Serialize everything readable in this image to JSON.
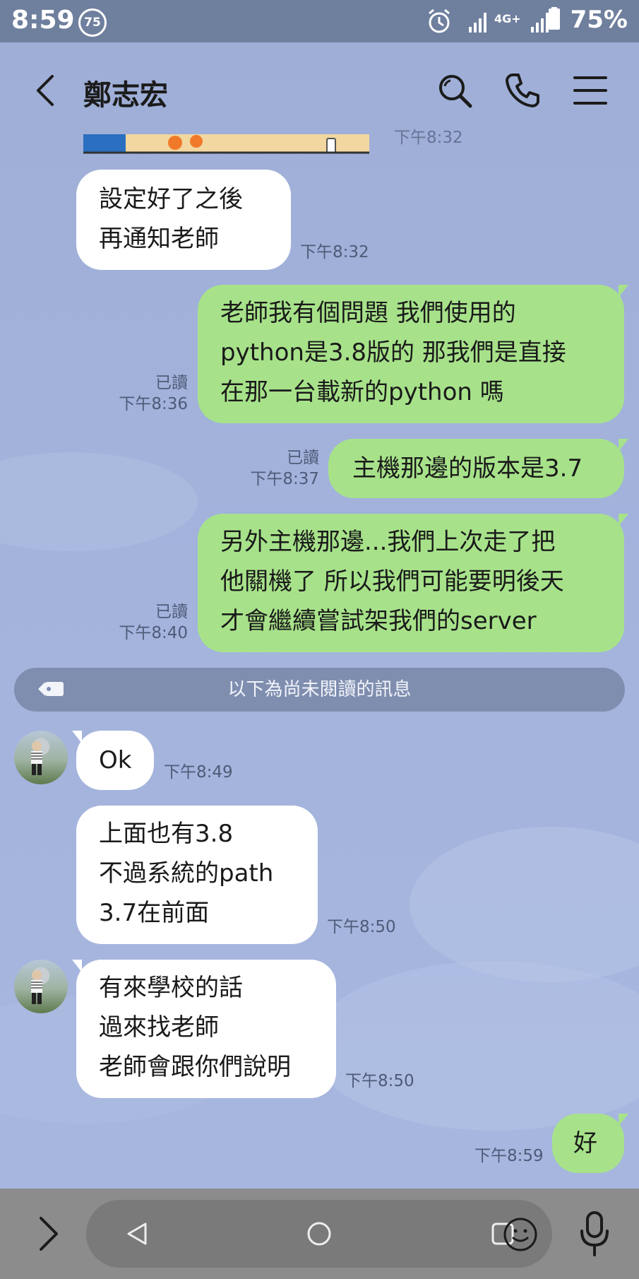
{
  "status_bar": {
    "time": "8:59",
    "notification_count": "75",
    "network": "4G+",
    "battery": "75%"
  },
  "header": {
    "contact_name": "鄭志宏",
    "icons": [
      "back-icon",
      "search-icon",
      "phone-icon",
      "menu-icon"
    ]
  },
  "messages": [
    {
      "side": "in",
      "lines": [
        "設定好了之後",
        "再通知老師"
      ],
      "time": "下午8:32"
    },
    {
      "side": "out",
      "lines": [
        "老師我有個問題 我們使用的",
        "python是3.8版的 那我們是直接",
        "在那一台載新的python 嗎"
      ],
      "read": "已讀",
      "time": "下午8:36"
    },
    {
      "side": "out",
      "lines": [
        "主機那邊的版本是3.7"
      ],
      "read": "已讀",
      "time": "下午8:37"
    },
    {
      "side": "out",
      "lines": [
        "另外主機那邊...我們上次走了把",
        "他關機了 所以我們可能要明後天",
        "才會繼續嘗試架我們的server"
      ],
      "read": "已讀",
      "time": "下午8:40"
    },
    {
      "side": "in",
      "lines": [
        "Ok"
      ],
      "time": "下午8:49"
    },
    {
      "side": "in",
      "lines": [
        "上面也有3.8",
        "不過系統的path",
        "3.7在前面"
      ],
      "time": "下午8:50"
    },
    {
      "side": "in",
      "lines": [
        "有來學校的話",
        "過來找老師",
        "老師會跟你們說明"
      ],
      "time": "下午8:50"
    },
    {
      "side": "out",
      "lines": [
        "好"
      ],
      "time": "下午8:59"
    }
  ],
  "partial_top_time": "下午8:32",
  "unread_divider": "以下為尚未閱讀的訊息",
  "colors": {
    "background": "#a3b3dc",
    "outgoing_bubble": "#a7e28a",
    "incoming_bubble": "#ffffff",
    "status_bar": "#6f7f9e",
    "input_bar": "#8c8c8c"
  },
  "input_bar": {
    "icons": [
      "expand-icon",
      "nav-back-icon",
      "nav-home-icon",
      "nav-recents-icon",
      "emoji-icon",
      "microphone-icon"
    ]
  }
}
